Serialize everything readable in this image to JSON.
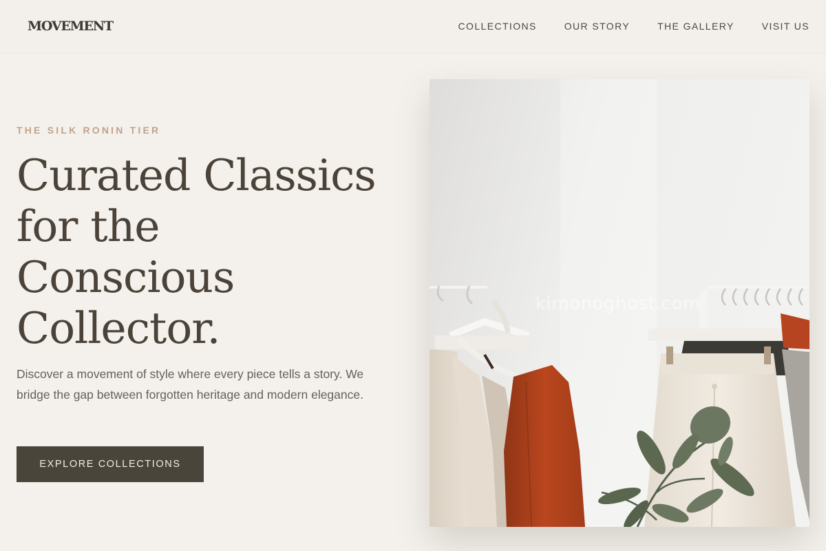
{
  "header": {
    "logo": "MOVEMENT",
    "nav": [
      {
        "label": "COLLECTIONS"
      },
      {
        "label": "OUR STORY"
      },
      {
        "label": "THE GALLERY"
      },
      {
        "label": "VISIT US"
      }
    ]
  },
  "hero": {
    "eyebrow": "THE SILK RONIN TIER",
    "headline_lines": [
      "Curated Classics",
      "for the",
      "Conscious",
      "Collector."
    ],
    "description": "Discover a movement of style where every piece tells a story. We bridge the gap between forgotten heritage and modern elegance.",
    "cta_label": "EXPLORE COLLECTIONS",
    "image_watermark": "kimonoghost.com"
  },
  "colors": {
    "background": "#f4f1ec",
    "text_dark": "#4b4339",
    "accent_eyebrow": "#bfa38e",
    "button_bg": "#4a453b",
    "rust_garment": "#b9461e"
  }
}
